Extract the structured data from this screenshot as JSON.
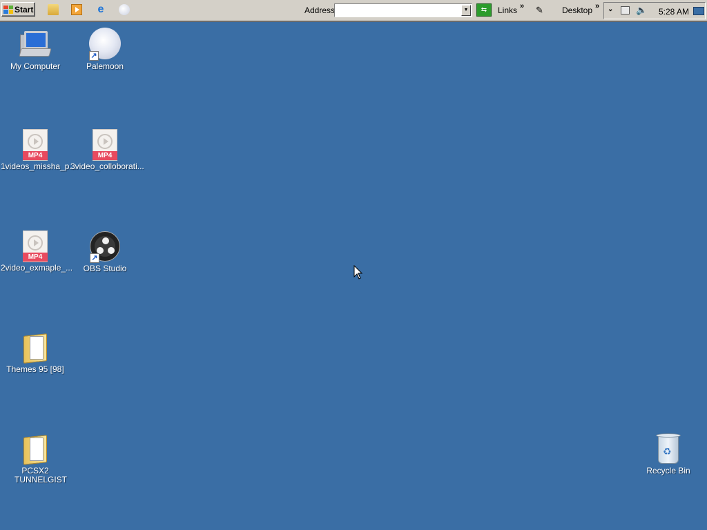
{
  "taskbar": {
    "start_label": "Start",
    "address_label": "Address",
    "address_value": "",
    "links_label": "Links",
    "desktop_label": "Desktop",
    "chevron": "»",
    "clock": "5:28 AM",
    "quick_launch": [
      "folder-icon",
      "media-player-icon",
      "internet-explorer-icon",
      "palemoon-icon"
    ],
    "tray_icons": [
      "network-icon",
      "volume-icon",
      "show-desktop-icon"
    ]
  },
  "desktop": {
    "background_color": "#3a6ea5",
    "icons": [
      {
        "label": "My Computer",
        "type": "computer"
      },
      {
        "label": "Palemoon",
        "type": "shortcut"
      },
      {
        "label": "1videos_missha_p...",
        "type": "mp4"
      },
      {
        "label": "3video_colloborati...",
        "type": "mp4"
      },
      {
        "label": "2video_exmaple_...",
        "type": "mp4"
      },
      {
        "label": "OBS Studio",
        "type": "shortcut"
      },
      {
        "label": "Themes 95 [98]",
        "type": "folder"
      },
      {
        "label": "PCSX2 TUNNELGIST",
        "type": "folder"
      },
      {
        "label": "Recycle Bin",
        "type": "recycle-bin"
      }
    ],
    "mp4_tag": "MP4"
  }
}
